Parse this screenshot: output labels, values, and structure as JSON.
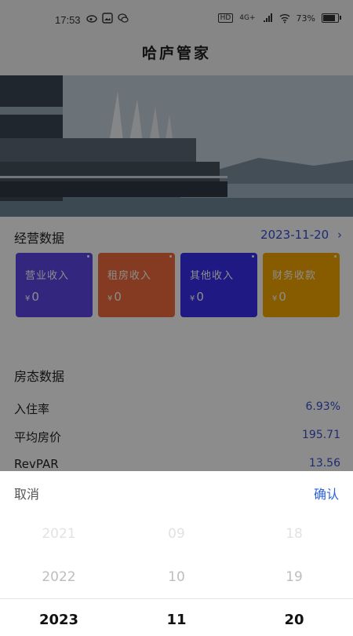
{
  "status_bar": {
    "time": "17:53",
    "left_icons": [
      "weibo-icon",
      "image-icon",
      "wechat-icon"
    ],
    "network": "4G+",
    "battery_percent": "73%",
    "battery_level": 0.73
  },
  "header": {
    "title": "哈庐管家"
  },
  "business": {
    "title": "经营数据",
    "date": "2023-11-20",
    "cards": [
      {
        "label": "营业收入",
        "currency": "¥",
        "value": "0",
        "color": "#5b46e6"
      },
      {
        "label": "租房收入",
        "currency": "¥",
        "value": "0",
        "color": "#f06c3c"
      },
      {
        "label": "其他收入",
        "currency": "¥",
        "value": "0",
        "color": "#3a2ff0"
      },
      {
        "label": "财务收款",
        "currency": "¥",
        "value": "0",
        "color": "#f6a800"
      }
    ]
  },
  "room_status": {
    "title": "房态数据",
    "metrics": [
      {
        "label": "入住率",
        "value": "6.93%"
      },
      {
        "label": "平均房价",
        "value": "195.71"
      },
      {
        "label": "RevPAR",
        "value": "13.56"
      }
    ]
  },
  "picker": {
    "cancel_label": "取消",
    "confirm_label": "确认",
    "years": [
      "2021",
      "2022",
      "2023"
    ],
    "months": [
      "09",
      "10",
      "11"
    ],
    "days": [
      "18",
      "19",
      "20"
    ],
    "selected": {
      "year": "2023",
      "month": "11",
      "day": "20"
    }
  },
  "colors": {
    "accent": "#3a4fd0",
    "confirm": "#2b63d9"
  }
}
